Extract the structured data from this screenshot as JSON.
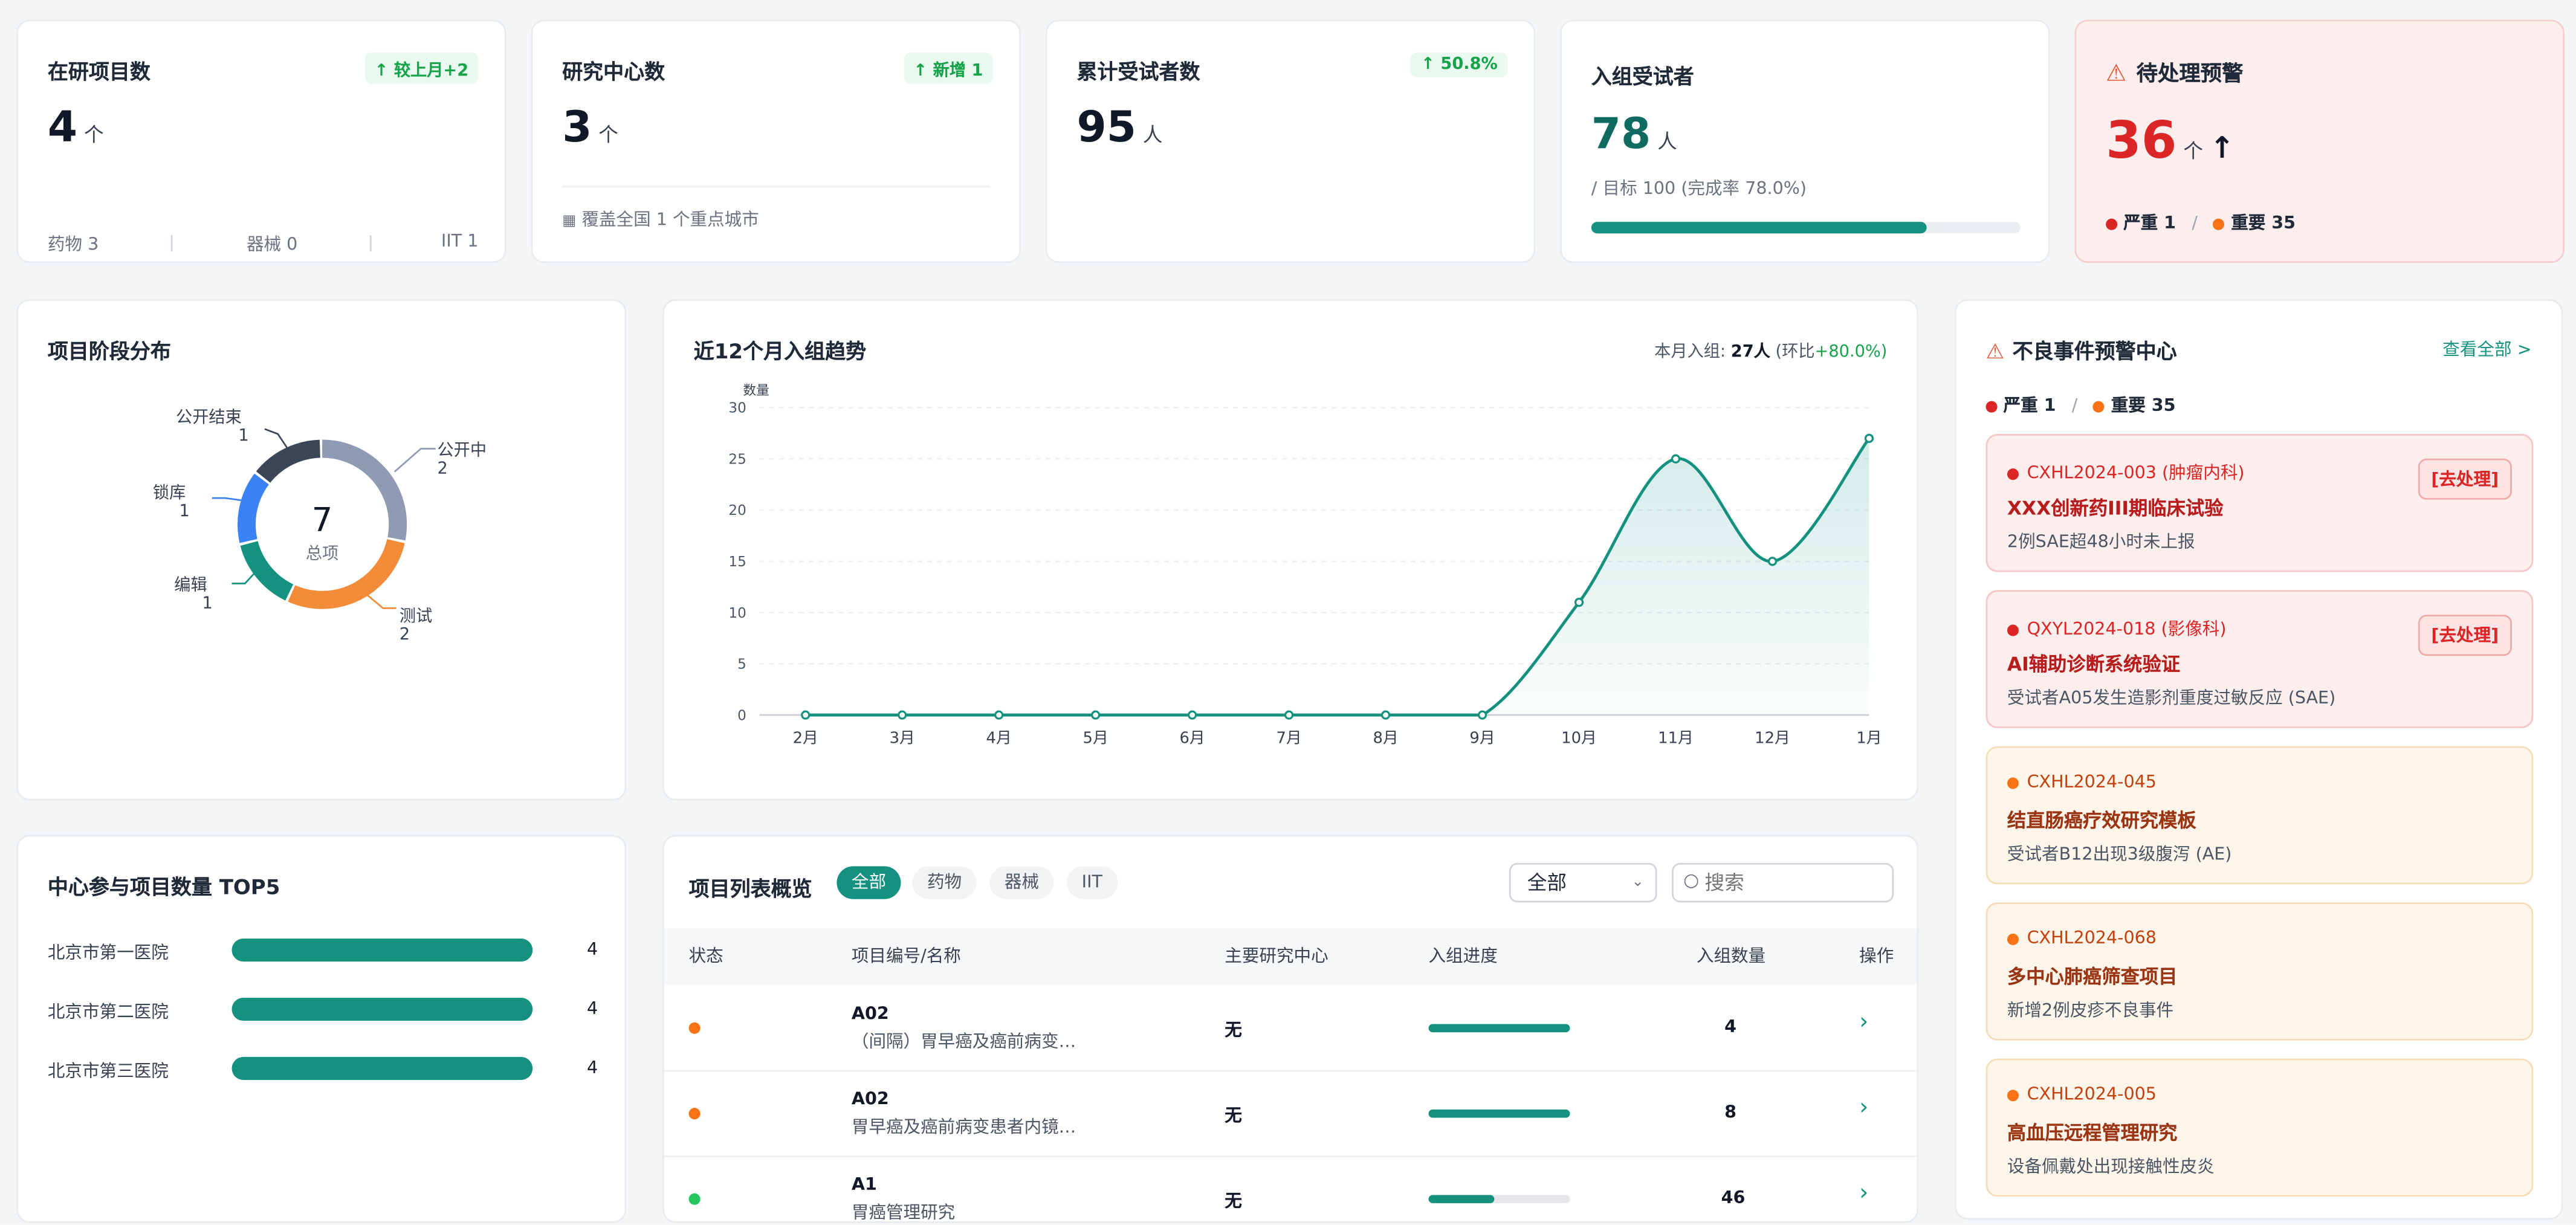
{
  "kpis": {
    "projects": {
      "title": "在研项目数",
      "badge": "↑ 较上月+2",
      "value": "4",
      "unit": "个",
      "foot": [
        {
          "label": "药物 3"
        },
        {
          "label": "器械 0"
        },
        {
          "label": "IIT 1"
        }
      ]
    },
    "centers": {
      "title": "研究中心数",
      "badge": "↑ 新增 1",
      "value": "3",
      "unit": "个",
      "foot": "覆盖全国 1 个重点城市"
    },
    "subjects": {
      "title": "累计受试者数",
      "badge": "↑ 50.8%",
      "value": "95",
      "unit": "人"
    },
    "enrolled": {
      "title": "入组受试者",
      "value": "78",
      "unit": "人",
      "target": "/ 目标 100 (完成率 78.0%)",
      "progress": 0.78
    },
    "alerts": {
      "title": "待处理预警",
      "value": "36",
      "unit": "个",
      "arrow": "↑",
      "severe": "严重 1",
      "important": "重要 35",
      "sep": "/"
    }
  },
  "phase": {
    "title": "项目阶段分布",
    "center_value": "7",
    "center_label": "总项",
    "segments": [
      {
        "name": "公开中",
        "value": 2,
        "color": "#8f9bb3"
      },
      {
        "name": "测试",
        "value": 2,
        "color": "#f28c38"
      },
      {
        "name": "编辑",
        "value": 1,
        "color": "#14917f"
      },
      {
        "name": "锁库",
        "value": 1,
        "color": "#3b82f6"
      },
      {
        "name": "公开结束",
        "value": 1,
        "color": "#3c4657"
      }
    ],
    "labels": {
      "pub_open": "公开中",
      "pub_open_v": "2",
      "test": "测试",
      "test_v": "2",
      "edit": "编辑",
      "edit_v": "1",
      "lock": "锁库",
      "lock_v": "1",
      "end": "公开结束",
      "end_v": "1"
    }
  },
  "trend": {
    "title": "近12个月入组趋势",
    "summary_prefix": "本月入组:",
    "summary_value": "27人",
    "summary_ratio_prefix": "(环比",
    "summary_ratio": "+80.0%)",
    "ylabel": "数量"
  },
  "chart_data": {
    "type": "area",
    "title": "近12个月入组趋势",
    "ylabel": "数量",
    "x": [
      "2月",
      "3月",
      "4月",
      "5月",
      "6月",
      "7月",
      "8月",
      "9月",
      "10月",
      "11月",
      "12月",
      "1月"
    ],
    "values": [
      0,
      0,
      0,
      0,
      0,
      0,
      0,
      0,
      11,
      25,
      15,
      27
    ],
    "ylim": [
      0,
      30
    ],
    "yticks": [
      0,
      5,
      10,
      15,
      20,
      25,
      30
    ],
    "grid": true
  },
  "warning_center": {
    "title": "不良事件预警中心",
    "view_all": "查看全部 >",
    "severe": "严重 1",
    "important": "重要 35",
    "sep": "/",
    "items": [
      {
        "code": "CXHL2024-003 (肿瘤内科)",
        "name": "XXX创新药III期临床试验",
        "desc": "2例SAE超48小时未上报",
        "action": "[去处理]",
        "level": "red"
      },
      {
        "code": "QXYL2024-018 (影像科)",
        "name": "AI辅助诊断系统验证",
        "desc": "受试者A05发生造影剂重度过敏反应 (SAE)",
        "action": "[去处理]",
        "level": "red"
      },
      {
        "code": "CXHL2024-045",
        "name": "结直肠癌疗效研究模板",
        "desc": "受试者B12出现3级腹泻 (AE)",
        "level": "orange"
      },
      {
        "code": "CXHL2024-068",
        "name": "多中心肺癌筛查项目",
        "desc": "新增2例皮疹不良事件",
        "level": "orange"
      },
      {
        "code": "CXHL2024-005",
        "name": "高血压远程管理研究",
        "desc": "设备佩戴处出现接触性皮炎",
        "level": "orange"
      }
    ]
  },
  "top5": {
    "title": "中心参与项目数量 TOP5",
    "items": [
      {
        "name": "北京市第一医院",
        "value": "4"
      },
      {
        "name": "北京市第二医院",
        "value": "4"
      },
      {
        "name": "北京市第三医院",
        "value": "4"
      }
    ]
  },
  "project_list": {
    "title": "项目列表概览",
    "filters": [
      "全部",
      "药物",
      "器械",
      "IIT"
    ],
    "select_value": "全部",
    "search_placeholder": "搜索",
    "columns": [
      "状态",
      "项目编号/名称",
      "主要研究中心",
      "入组进度",
      "入组数量",
      "操作"
    ],
    "rows": [
      {
        "status_color": "#f97316",
        "code": "A02",
        "name": "（间隔）胃早癌及癌前病变…",
        "center": "无",
        "progress": 1.0,
        "count": "4",
        "action": "›"
      },
      {
        "status_color": "#f97316",
        "code": "A02",
        "name": "胃早癌及癌前病变患者内镜…",
        "center": "无",
        "progress": 1.0,
        "count": "8",
        "action": "›"
      },
      {
        "status_color": "#22c55e",
        "code": "A1",
        "name": "胃癌管理研究",
        "center": "无",
        "progress": 0.46,
        "count": "46",
        "action": "›"
      }
    ]
  }
}
